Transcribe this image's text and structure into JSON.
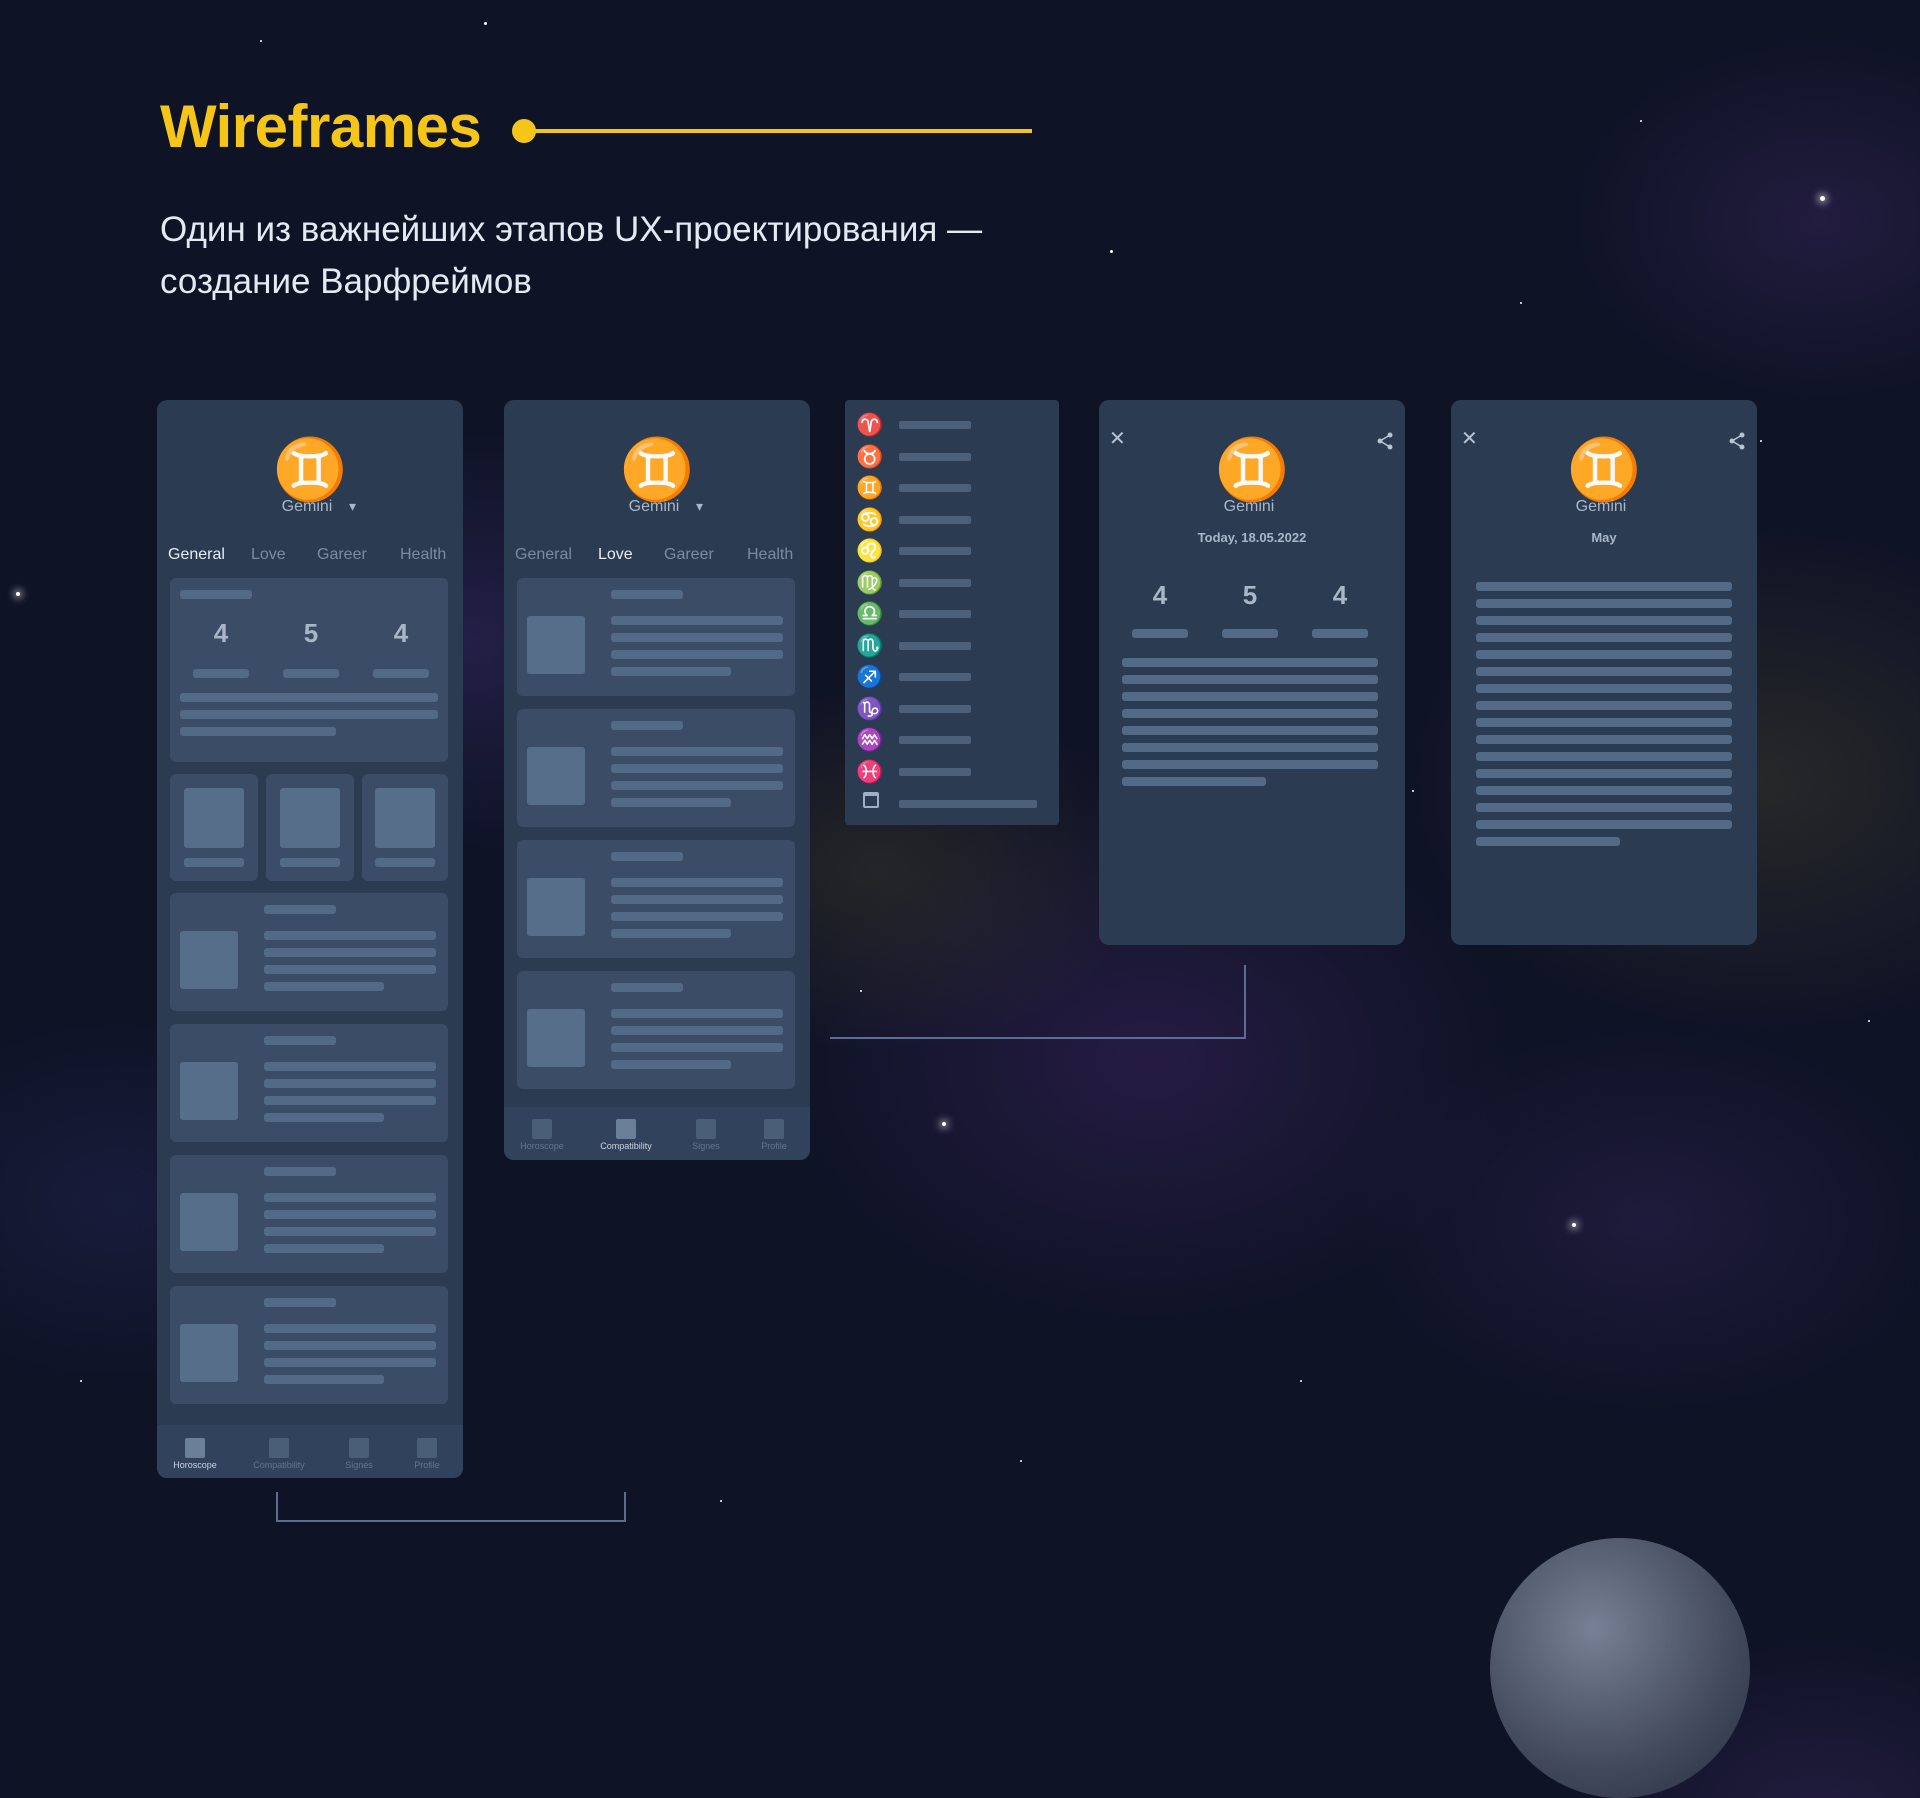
{
  "header": {
    "title": "Wireframes",
    "subtitle_line1": "Один из важнейших этапов UX-проектирования —",
    "subtitle_line2": "создание Варфреймов",
    "accent": "#f5c518"
  },
  "sign": {
    "symbol": "♊",
    "name": "Gemini",
    "dropdown": "▾"
  },
  "tabs": [
    "General",
    "Love",
    "Gareer",
    "Health"
  ],
  "scores": [
    "4",
    "5",
    "4"
  ],
  "nav": [
    "Horoscope",
    "Compatibility",
    "Signes",
    "Profile"
  ],
  "zodiac_icons": [
    "♈",
    "♉",
    "♊",
    "♋",
    "♌",
    "♍",
    "♎",
    "♏",
    "♐",
    "♑",
    "♒",
    "♓"
  ],
  "calendar_icon": "calendar-icon",
  "detail_today": {
    "date": "Today, 18.05.2022",
    "close": "✕",
    "share": "share-icon"
  },
  "detail_month": {
    "period": "May",
    "close": "✕"
  },
  "colors": {
    "panel": "#2b3b52",
    "card": "#3a4c66",
    "background": "#0f1326"
  }
}
